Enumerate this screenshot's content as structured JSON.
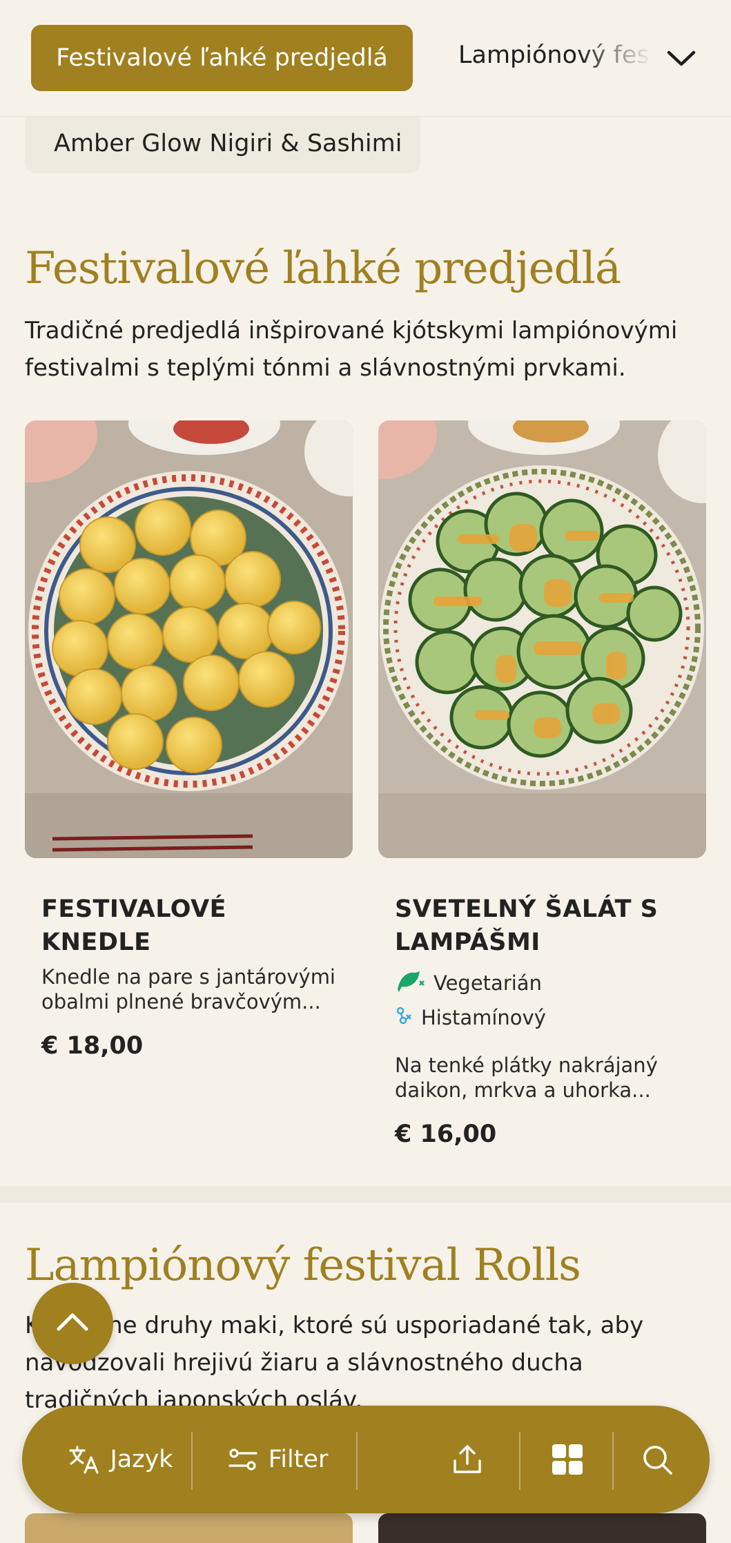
{
  "nav": {
    "active_tab": "Festivalové ľahké predjedlá",
    "next_tab": "Lampiónový festival Rolls",
    "prev_category": "Amber Glow Nigiri & Sashimi"
  },
  "section1": {
    "title": "Festivalové ľahké predjedlá",
    "description": "Tradičné predjedlá inšpirované kjótskymi lampiónovými festivalmi s teplými tónmi a slávnostnými prvkami."
  },
  "dishes": [
    {
      "name": "FESTIVALOVÉ KNEDLE",
      "description": "Knedle na pare s jantárovými obalmi plnené bravčovým...",
      "price": "€ 18,00",
      "tags": []
    },
    {
      "name": "SVETELNÝ ŠALÁT S LAMPÁŠMI",
      "description": "Na tenké plátky nakrájaný daikon, mrkva a uhorka...",
      "price": "€ 16,00",
      "tags": [
        {
          "label": "Vegetarián",
          "icon": "vegetarian-icon",
          "color": "#1aa56b"
        },
        {
          "label": "Histamínový",
          "icon": "histamine-icon",
          "color": "#3aa6d8"
        }
      ]
    }
  ],
  "section2": {
    "title": "Lampiónový festival Rolls",
    "description": "Kreatívne druhy maki, ktoré sú usporiadané tak, aby navodzovali hrejivú žiaru a slávnostného ducha tradičných japonských osláv."
  },
  "bottom_bar": {
    "language_label": "Jazyk",
    "filter_label": "Filter"
  },
  "colors": {
    "accent": "#a0801f",
    "background": "#f6f2ea",
    "pill": "#efeadf"
  }
}
